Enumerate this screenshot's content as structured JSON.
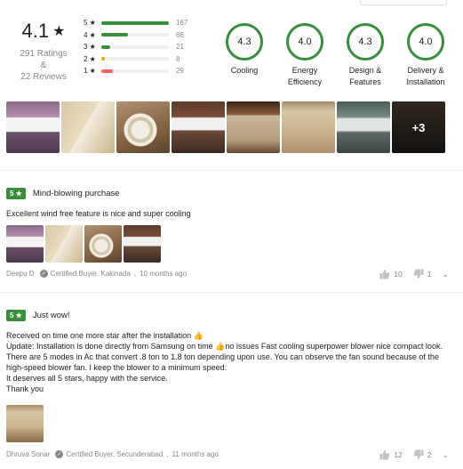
{
  "summary": {
    "rating": "4.1",
    "ratings_text": "291 Ratings &",
    "reviews_text": "22 Reviews",
    "distribution": [
      {
        "label": "5 ★",
        "count": "167",
        "fraction": 1.0,
        "color": "#388e3c"
      },
      {
        "label": "4 ★",
        "count": "66",
        "fraction": 0.4,
        "color": "#388e3c"
      },
      {
        "label": "3 ★",
        "count": "21",
        "fraction": 0.13,
        "color": "#388e3c"
      },
      {
        "label": "2 ★",
        "count": "8",
        "fraction": 0.05,
        "color": "#ff9f00"
      },
      {
        "label": "1 ★",
        "count": "29",
        "fraction": 0.17,
        "color": "#ff6161"
      }
    ],
    "aspects": [
      {
        "value": "4.3",
        "label_1": "Cooling",
        "label_2": ""
      },
      {
        "value": "4.0",
        "label_1": "Energy",
        "label_2": "Efficiency"
      },
      {
        "value": "4.3",
        "label_1": "Design &",
        "label_2": "Features"
      },
      {
        "value": "4.0",
        "label_1": "Delivery &",
        "label_2": "Installation"
      }
    ],
    "more_photos": "+3"
  },
  "reviews": [
    {
      "stars": "5 ★",
      "title": "Mind-blowing purchase",
      "body": [
        "Excellent wind free feature is nice and super cooling"
      ],
      "author": "Deepu D",
      "certified": "Certified Buyer, Kakinada",
      "age": "10 months ago",
      "likes": "10",
      "dislikes": "1"
    },
    {
      "stars": "5 ★",
      "title": "Just wow!",
      "body": [
        "Received on time one more star after the installation 👍",
        "Update: Installation is done directly from Samsung on time 👍no issues Fast cooling superpower blower nice compact look. There are 5 modes in Ac that convert .8 ton to 1.8 ton depending upon use. You can observe the fan sound because of the high-speed blower fan. I keep the blower to a minimum speed.",
        "It deserves all 5 stars, happy with the service.",
        "Thank you"
      ],
      "author": "Dhruva Sonar",
      "certified": "Certified Buyer, Secunderabad",
      "age": "11 months ago",
      "likes": "12",
      "dislikes": "2"
    }
  ],
  "colors": {
    "green": "#388e3c",
    "muted": "#878787"
  }
}
